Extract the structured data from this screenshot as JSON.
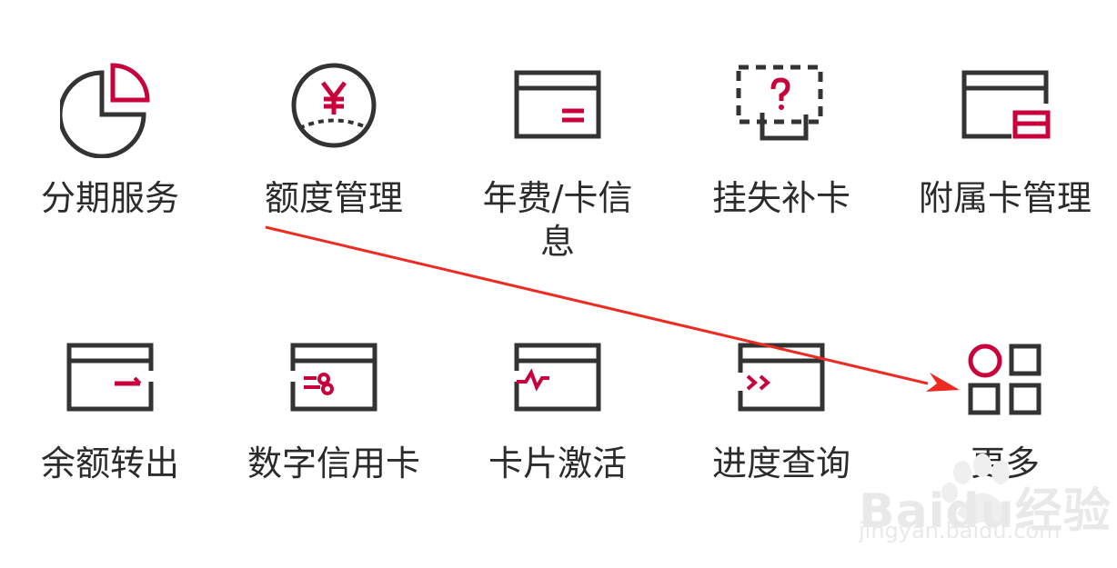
{
  "colors": {
    "stroke": "#333333",
    "accent": "#c8003c",
    "arrow": "#ee2b22",
    "watermark": "#e5e5e5"
  },
  "menu": {
    "row1": [
      {
        "label": "分期服务",
        "icon": "installment-pie-icon"
      },
      {
        "label": "额度管理",
        "icon": "credit-limit-yen-icon"
      },
      {
        "label": "年费/卡信息",
        "icon": "card-info-icon"
      },
      {
        "label": "挂失补卡",
        "icon": "report-loss-card-icon"
      },
      {
        "label": "附属卡管理",
        "icon": "supplementary-card-icon"
      }
    ],
    "row2": [
      {
        "label": "余额转出",
        "icon": "balance-transfer-card-icon"
      },
      {
        "label": "数字信用卡",
        "icon": "digital-card-icon"
      },
      {
        "label": "卡片激活",
        "icon": "card-activation-icon"
      },
      {
        "label": "进度查询",
        "icon": "progress-query-icon"
      },
      {
        "label": "更多",
        "icon": "more-grid-icon"
      }
    ]
  },
  "watermark": {
    "brand": "Baidu经验",
    "url": "jingyan.baidu.com"
  }
}
